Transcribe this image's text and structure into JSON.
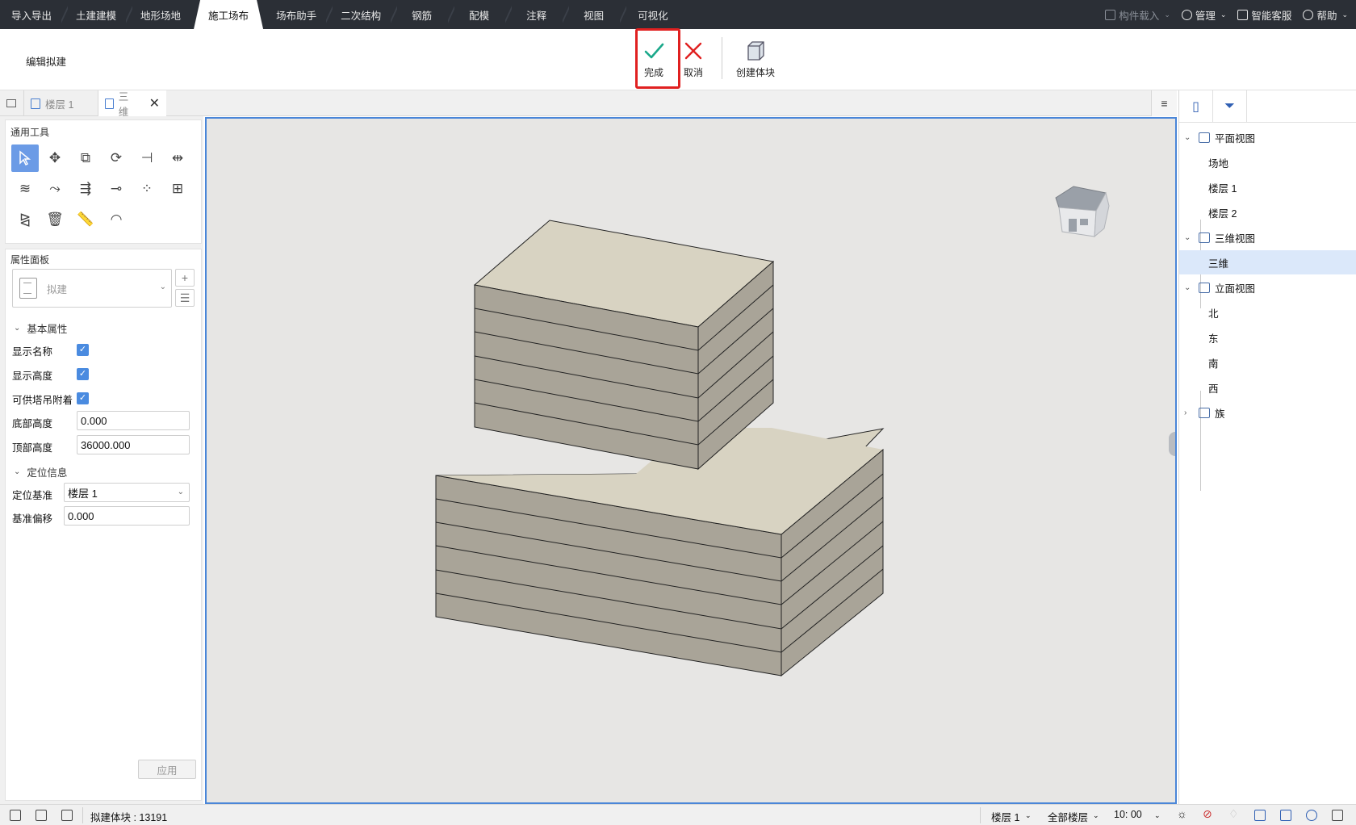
{
  "menu": {
    "tabs": [
      "导入导出",
      "土建建模",
      "地形场地",
      "施工场布",
      "场布助手",
      "二次结构",
      "钢筋",
      "配模",
      "注释",
      "视图",
      "可视化"
    ],
    "active_index": 3,
    "right": {
      "component_load": "构件载入",
      "manage": "管理",
      "smart_service": "智能客服",
      "help": "帮助"
    }
  },
  "ribbon": {
    "title": "编辑拟建",
    "done": "完成",
    "cancel": "取消",
    "create_block": "创建体块"
  },
  "doc_tabs": {
    "tab1": "楼层 1",
    "tab2": "三维"
  },
  "tools": {
    "title": "通用工具",
    "icons": [
      "select-icon",
      "move-icon",
      "copy-icon",
      "rotate-icon",
      "align-icon",
      "split-icon",
      "offset-icon",
      "stretch-icon",
      "extend-icon",
      "trim-icon",
      "array-icon",
      "group-icon",
      "mirror-icon",
      "delete-icon",
      "measure-icon",
      "angle-icon"
    ]
  },
  "properties": {
    "title": "属性面板",
    "type_name": "拟建",
    "group_basic": "基本属性",
    "show_name": "显示名称",
    "show_height": "显示高度",
    "tower_crane_attach": "可供塔吊附着",
    "bottom_height_label": "底部高度",
    "bottom_height_value": "0.000",
    "top_height_label": "顶部高度",
    "top_height_value": "36000.000",
    "group_position": "定位信息",
    "base_label": "定位基准",
    "base_value": "楼层 1",
    "offset_label": "基准偏移",
    "offset_value": "0.000",
    "apply": "应用"
  },
  "tree": {
    "plan_views": "平面视图",
    "site": "场地",
    "floor1": "楼层 1",
    "floor2": "楼层 2",
    "views_3d": "三维视图",
    "view_3d": "三维",
    "elevation_views": "立面视图",
    "north": "北",
    "east": "东",
    "south": "南",
    "west": "西",
    "families": "族"
  },
  "status": {
    "block_count": "拟建体块 : 13191",
    "floor": "楼层 1",
    "all_floors": "全部楼层",
    "time": "10: 00"
  },
  "colors": {
    "top_face": "#d8d3c2",
    "side_face": "#a9a498",
    "accent": "#4a86d8",
    "highlight": "#e02020"
  }
}
